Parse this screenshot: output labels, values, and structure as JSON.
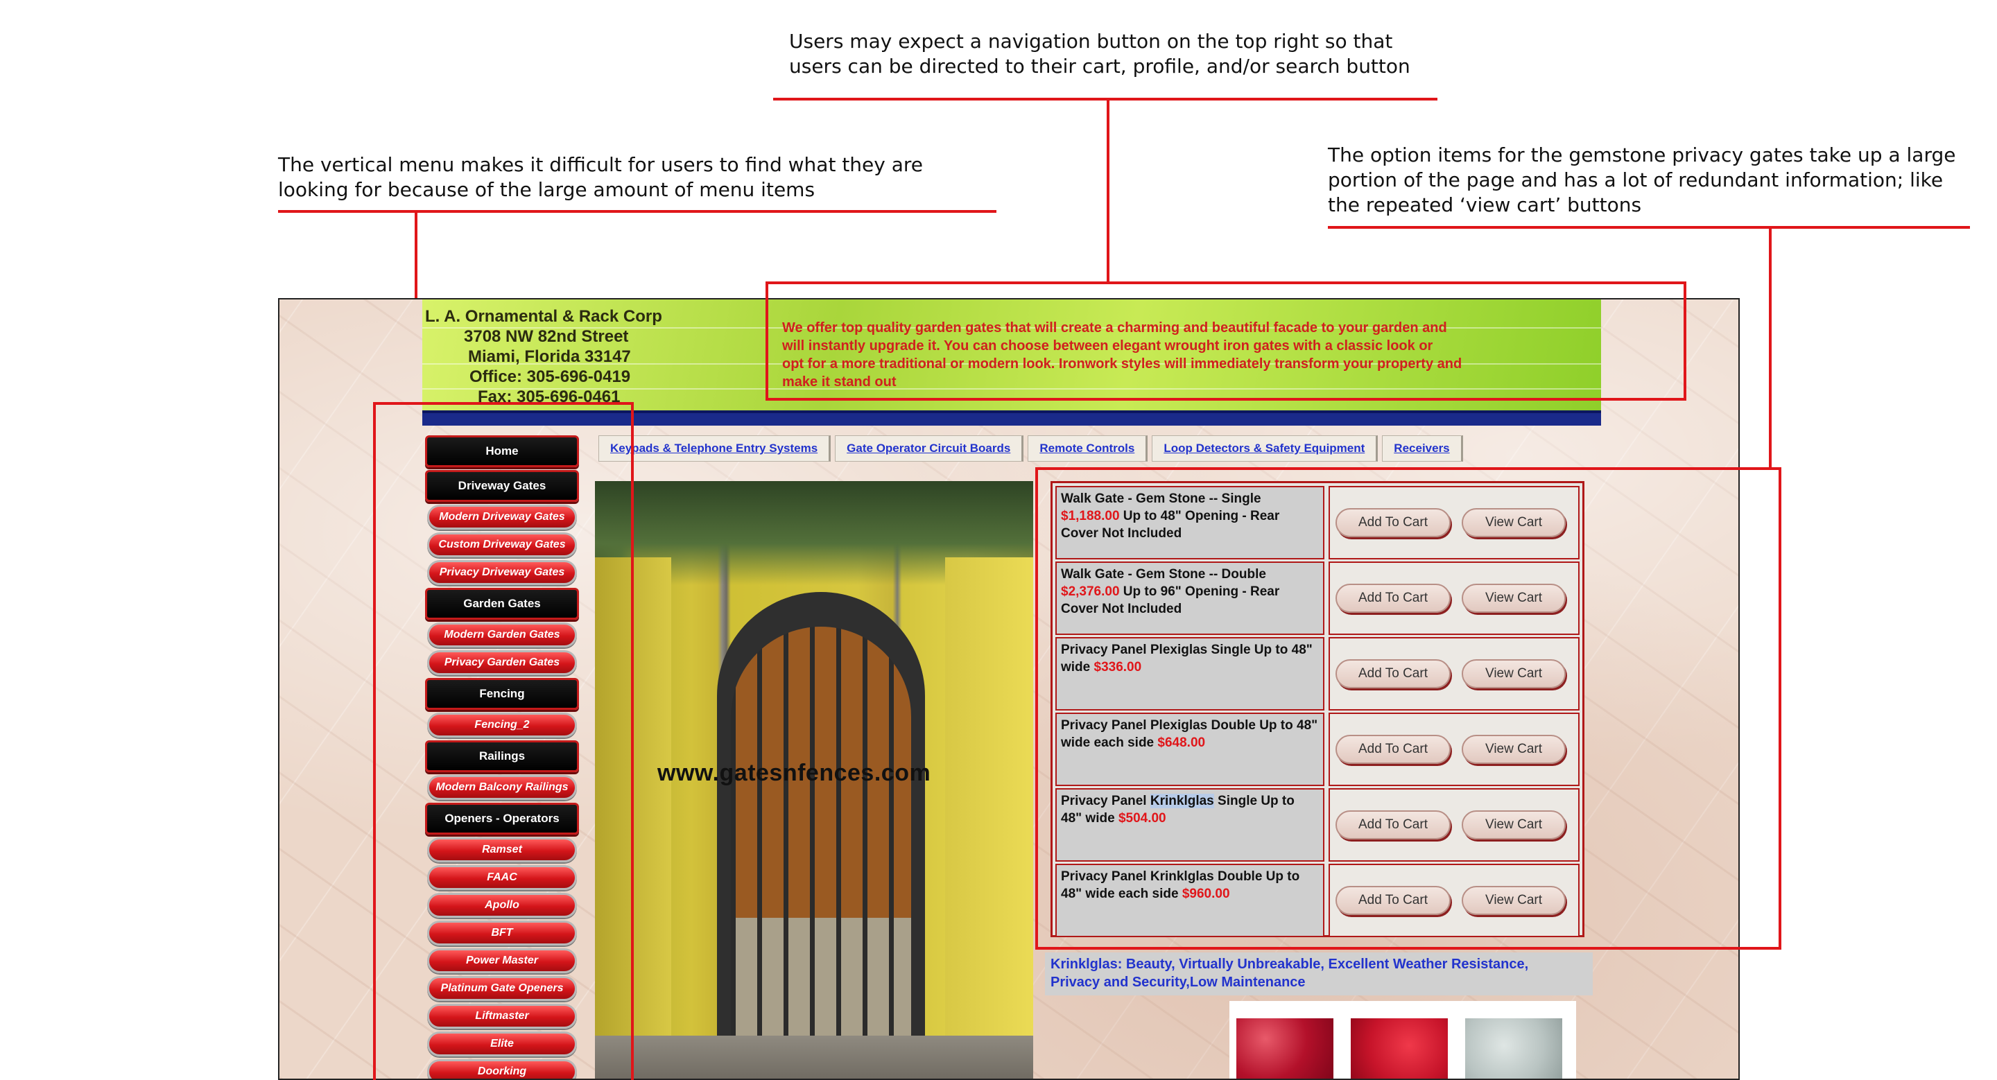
{
  "annotations": {
    "nav_note": {
      "line1": "Users may expect a navigation button on the top right so that",
      "line2": "users can be directed to their cart, profile, and/or search button"
    },
    "menu_note": {
      "line1": "The vertical menu makes it difficult for users to find what they are",
      "line2": "looking for because of the large amount of menu items"
    },
    "options_note": {
      "line1": "The option items for the gemstone privacy gates take up a large",
      "line2": "portion of the page and has a lot of redundant information; like",
      "line3": "the repeated ‘view cart’ buttons"
    },
    "accent_color": "#e0161a"
  },
  "site": {
    "company": {
      "name": "L. A. Ornamental & Rack Corp",
      "street": "3708 NW 82nd Street",
      "city": "Miami, Florida 33147",
      "office": "Office: 305-696-0419",
      "fax": "Fax: 305-696-0461"
    },
    "tagline": {
      "line1": "We offer top quality garden gates that will create a charming and beautiful facade to your garden and",
      "line2": "will instantly upgrade it. You can choose between elegant wrought iron gates with a classic look or",
      "line3": "opt for a more traditional or modern look. Ironwork styles will immediately transform your property and",
      "line4": "make it stand out"
    },
    "top_nav": [
      {
        "label": "Keypads & Telephone Entry Systems"
      },
      {
        "label": "Gate Operator Circuit Boards"
      },
      {
        "label": "Remote Controls"
      },
      {
        "label": "Loop Detectors & Safety Equipment"
      },
      {
        "label": "Receivers"
      }
    ],
    "side_menu": [
      {
        "label": "Home"
      },
      {
        "label": "Driveway Gates"
      },
      {
        "label": "Modern Driveway Gates"
      },
      {
        "label": "Custom Driveway Gates"
      },
      {
        "label": "Privacy Driveway Gates"
      },
      {
        "label": "Garden Gates"
      },
      {
        "label": "Modern Garden Gates"
      },
      {
        "label": "Privacy Garden Gates"
      },
      {
        "label": "Fencing"
      },
      {
        "label": "Fencing_2"
      },
      {
        "label": "Railings"
      },
      {
        "label": "Modern Balcony Railings"
      },
      {
        "label": "Openers - Operators"
      },
      {
        "label": "Ramset"
      },
      {
        "label": "FAAC"
      },
      {
        "label": "Apollo"
      },
      {
        "label": "BFT"
      },
      {
        "label": "Power Master"
      },
      {
        "label": "Platinum Gate Openers"
      },
      {
        "label": "Liftmaster"
      },
      {
        "label": "Elite"
      },
      {
        "label": "Doorking"
      }
    ],
    "watermark": "www.gatesnfences.com",
    "products": [
      {
        "pre": "Walk Gate - Gem Stone -- Single ",
        "price": "$1,188.00",
        "post": " Up to 48\" Opening - Rear Cover Not Included"
      },
      {
        "pre": "Walk Gate - Gem Stone -- Double ",
        "price": "$2,376.00",
        "post": " Up to 96\" Opening - Rear Cover Not Included"
      },
      {
        "pre": "Privacy Panel Plexiglas Single Up to 48\" wide ",
        "price": "$336.00",
        "post": ""
      },
      {
        "pre": "Privacy Panel Plexiglas Double Up to 48\" wide each side ",
        "price": "$648.00",
        "post": ""
      },
      {
        "pre": "Privacy Panel Krinklglas Single Up to 48\" wide ",
        "price": "$504.00",
        "post": ""
      },
      {
        "pre": "Privacy Panel Krinklglas Double Up to 48\" wide each side ",
        "price": "$960.00",
        "post": ""
      }
    ],
    "add_to_cart_label": "Add To Cart",
    "view_cart_label": "View Cart",
    "krinklglas_note": {
      "line1": "Krinklglas: Beauty, Virtually Unbreakable, Excellent Weather Resistance,",
      "line2": "Privacy and Security,Low Maintenance"
    },
    "colors": {
      "price_red": "#e0161a",
      "link_blue": "#2233cc",
      "nav_bar_blue": "#1a2a8a"
    }
  }
}
